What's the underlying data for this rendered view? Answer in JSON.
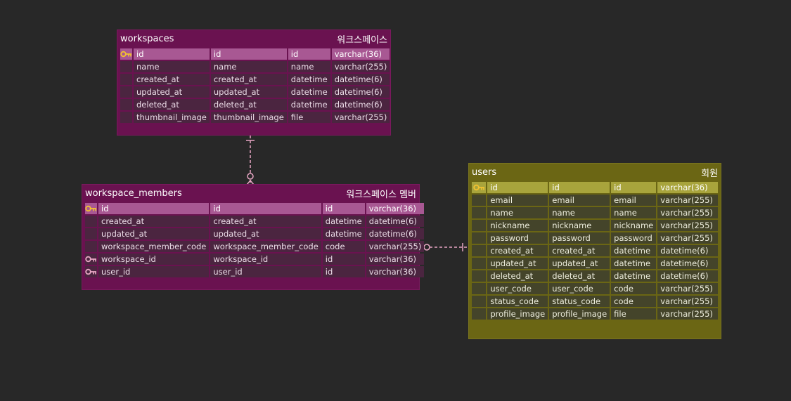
{
  "colors": {
    "background": "#282828",
    "magenta_header": "#6a1250",
    "magenta_pk_row": "#a85893",
    "olive_header": "#6b6614",
    "olive_pk_row": "#a8a43c",
    "relation_line": "#e8a6c4",
    "pk_key_icon": "#f2c230",
    "fk_key_icon": "#e8a6c4"
  },
  "entities": {
    "workspaces": {
      "name": "workspaces",
      "comment": "워크스페이스",
      "columns": [
        {
          "key": "pk",
          "physical": "id",
          "logical": "id",
          "domain": "id",
          "type": "varchar(36)"
        },
        {
          "key": "",
          "physical": "name",
          "logical": "name",
          "domain": "name",
          "type": "varchar(255)"
        },
        {
          "key": "",
          "physical": "created_at",
          "logical": "created_at",
          "domain": "datetime",
          "type": "datetime(6)"
        },
        {
          "key": "",
          "physical": "updated_at",
          "logical": "updated_at",
          "domain": "datetime",
          "type": "datetime(6)"
        },
        {
          "key": "",
          "physical": "deleted_at",
          "logical": "deleted_at",
          "domain": "datetime",
          "type": "datetime(6)"
        },
        {
          "key": "",
          "physical": "thumbnail_image",
          "logical": "thumbnail_image",
          "domain": "file",
          "type": "varchar(255)"
        }
      ]
    },
    "workspace_members": {
      "name": "workspace_members",
      "comment": "워크스페이스 멤버",
      "columns": [
        {
          "key": "pk",
          "physical": "id",
          "logical": "id",
          "domain": "id",
          "type": "varchar(36)"
        },
        {
          "key": "",
          "physical": "created_at",
          "logical": "created_at",
          "domain": "datetime",
          "type": "datetime(6)"
        },
        {
          "key": "",
          "physical": "updated_at",
          "logical": "updated_at",
          "domain": "datetime",
          "type": "datetime(6)"
        },
        {
          "key": "",
          "physical": "workspace_member_code",
          "logical": "workspace_member_code",
          "domain": "code",
          "type": "varchar(255)"
        },
        {
          "key": "fk",
          "physical": "workspace_id",
          "logical": "workspace_id",
          "domain": "id",
          "type": "varchar(36)"
        },
        {
          "key": "fk",
          "physical": "user_id",
          "logical": "user_id",
          "domain": "id",
          "type": "varchar(36)"
        }
      ]
    },
    "users": {
      "name": "users",
      "comment": "회원",
      "columns": [
        {
          "key": "pk",
          "physical": "id",
          "logical": "id",
          "domain": "id",
          "type": "varchar(36)"
        },
        {
          "key": "",
          "physical": "email",
          "logical": "email",
          "domain": "email",
          "type": "varchar(255)"
        },
        {
          "key": "",
          "physical": "name",
          "logical": "name",
          "domain": "name",
          "type": "varchar(255)"
        },
        {
          "key": "",
          "physical": "nickname",
          "logical": "nickname",
          "domain": "nickname",
          "type": "varchar(255)"
        },
        {
          "key": "",
          "physical": "password",
          "logical": "password",
          "domain": "password",
          "type": "varchar(255)"
        },
        {
          "key": "",
          "physical": "created_at",
          "logical": "created_at",
          "domain": "datetime",
          "type": "datetime(6)"
        },
        {
          "key": "",
          "physical": "updated_at",
          "logical": "updated_at",
          "domain": "datetime",
          "type": "datetime(6)"
        },
        {
          "key": "",
          "physical": "deleted_at",
          "logical": "deleted_at",
          "domain": "datetime",
          "type": "datetime(6)"
        },
        {
          "key": "",
          "physical": "user_code",
          "logical": "user_code",
          "domain": "code",
          "type": "varchar(255)"
        },
        {
          "key": "",
          "physical": "status_code",
          "logical": "status_code",
          "domain": "code",
          "type": "varchar(255)"
        },
        {
          "key": "",
          "physical": "profile_image",
          "logical": "profile_image",
          "domain": "file",
          "type": "varchar(255)"
        }
      ]
    }
  },
  "relationships": [
    {
      "from": "workspaces",
      "to": "workspace_members",
      "from_end": "one-only",
      "to_end": "zero-or-many"
    },
    {
      "from": "users",
      "to": "workspace_members",
      "from_end": "one-only",
      "to_end": "zero-or-many"
    }
  ]
}
